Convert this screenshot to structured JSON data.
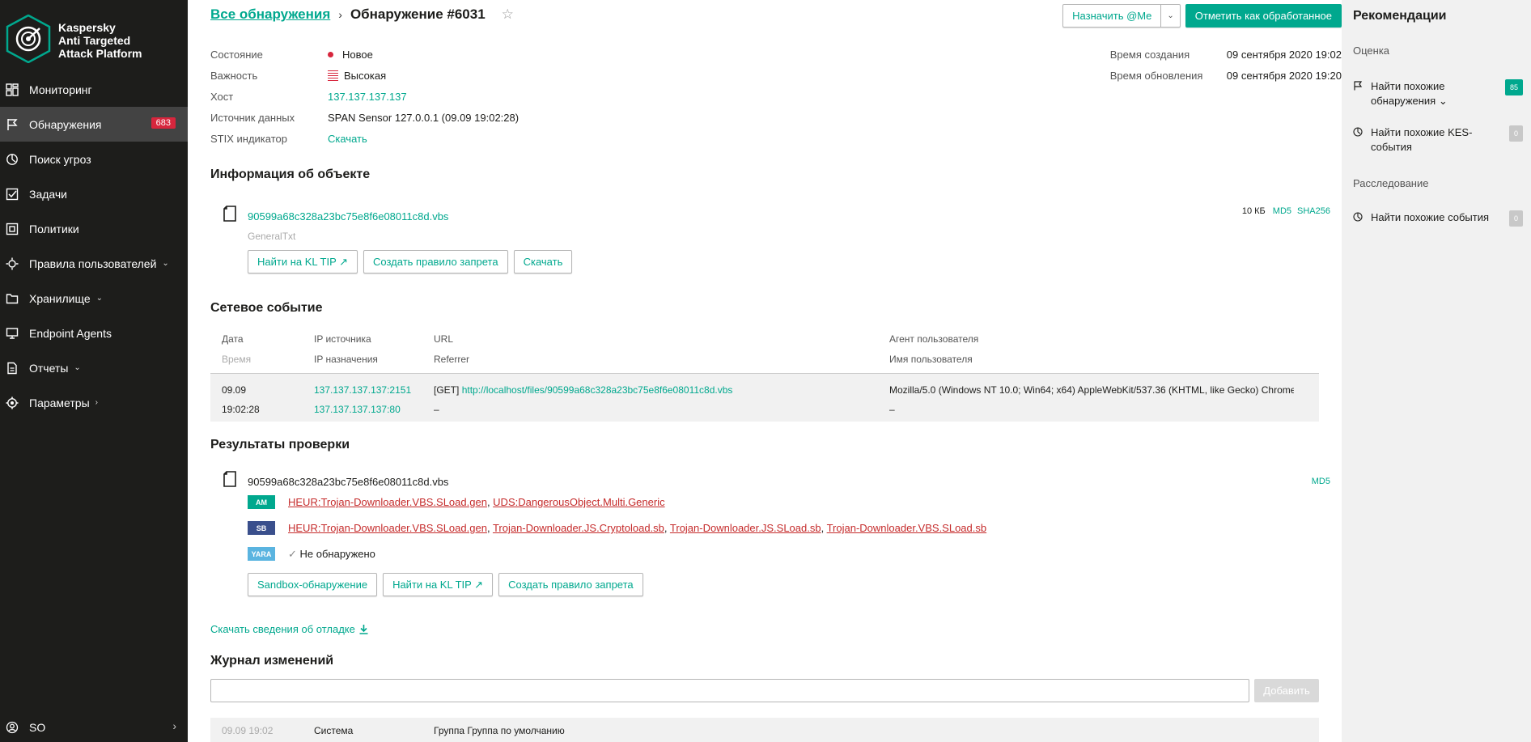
{
  "brand": {
    "line1": "Kaspersky",
    "line2": "Anti Targeted",
    "line3": "Attack Platform"
  },
  "nav": [
    {
      "label": "Мониторинг",
      "icon": "dashboard-icon"
    },
    {
      "label": "Обнаружения",
      "icon": "flag-icon",
      "badge": "683",
      "active": true
    },
    {
      "label": "Поиск угроз",
      "icon": "threat-hunting-icon"
    },
    {
      "label": "Задачи",
      "icon": "tasks-icon"
    },
    {
      "label": "Политики",
      "icon": "policies-icon"
    },
    {
      "label": "Правила пользователей",
      "icon": "user-rules-icon",
      "chevron": "⌄"
    },
    {
      "label": "Хранилище",
      "icon": "storage-icon",
      "chevron": "⌄"
    },
    {
      "label": "Endpoint Agents",
      "icon": "monitor-icon"
    },
    {
      "label": "Отчеты",
      "icon": "reports-icon",
      "chevron": "⌄"
    },
    {
      "label": "Параметры",
      "icon": "settings-icon",
      "chevron": "›"
    }
  ],
  "user": {
    "label": "SO",
    "arrow": "›"
  },
  "breadcrumb": {
    "link": "Все обнаружения",
    "sep": "›",
    "current": "Обнаружение #6031",
    "star": "☆"
  },
  "actions": {
    "assign": "Назначить @Me",
    "assign_arrow": "⌄",
    "mark": "Отметить как обработанное"
  },
  "props": {
    "state_label": "Состояние",
    "state_value": "Новое",
    "severity_label": "Важность",
    "severity_value": "Высокая",
    "host_label": "Хост",
    "host_value": "137.137.137.137",
    "source_label": "Источник данных",
    "source_value": "SPAN Sensor 127.0.0.1 (09.09 19:02:28)",
    "stix_label": "STIX индикатор",
    "stix_value": "Скачать"
  },
  "times": {
    "created_label": "Время создания",
    "created_value": "09 сентября 2020 19:02",
    "updated_label": "Время обновления",
    "updated_value": "09 сентября 2020 19:20"
  },
  "object_info": {
    "title": "Информация об объекте",
    "filename": "90599a68c328a23bc75e8f6e08011c8d.vbs",
    "type": "GeneralTxt",
    "size": "10 КБ",
    "md5": "MD5",
    "sha256": "SHA256",
    "btn_kltip": "Найти на KL TIP ↗",
    "btn_rule": "Создать правило запрета",
    "btn_download": "Скачать"
  },
  "network": {
    "title": "Сетевое событие",
    "headers": {
      "date": "Дата",
      "time": "Время",
      "src_ip": "IP источника",
      "dst_ip": "IP назначения",
      "url": "URL",
      "referrer": "Referrer",
      "ua": "Агент пользователя",
      "username": "Имя пользователя"
    },
    "row": {
      "date": "09.09",
      "time": "19:02:28",
      "src_ip": "137.137.137.137:2151",
      "dst_ip": "137.137.137.137:80",
      "method": "[GET]",
      "url": "http://localhost/files/90599a68c328a23bc75e8f6e08011c8d.vbs",
      "referrer": "–",
      "ua": "Mozilla/5.0 (Windows NT 10.0; Win64; x64) AppleWebKit/537.36 (KHTML, like Gecko) Chrome...",
      "username": "–"
    }
  },
  "scan": {
    "title": "Результаты проверки",
    "filename": "90599a68c328a23bc75e8f6e08011c8d.vbs",
    "md5": "MD5",
    "am_tag": "AM",
    "sb_tag": "SB",
    "yara_tag": "YARA",
    "am": [
      "HEUR:Trojan-Downloader.VBS.SLoad.gen",
      "UDS:DangerousObject.Multi.Generic"
    ],
    "sb": [
      "HEUR:Trojan-Downloader.VBS.SLoad.gen",
      "Trojan-Downloader.JS.Cryptoload.sb",
      "Trojan-Downloader.JS.SLoad.sb",
      "Trojan-Downloader.VBS.SLoad.sb"
    ],
    "yara_check": "✓",
    "yara": "Не обнаружено",
    "btn_sandbox": "Sandbox-обнаружение",
    "btn_kltip": "Найти на KL TIP ↗",
    "btn_rule": "Создать правило запрета"
  },
  "debug_link": "Скачать сведения об отладке",
  "log": {
    "title": "Журнал изменений",
    "input_value": "",
    "add": "Добавить",
    "row": {
      "date": "09.09 19:02",
      "actor": "Система",
      "text": "Группа Группа по умолчанию"
    }
  },
  "recommendations": {
    "title": "Рекомендации",
    "assessment": "Оценка",
    "similar_detections": "Найти похожие обнаружения ⌄",
    "similar_detections_count": "85",
    "similar_kes": "Найти похожие KES-события",
    "similar_kes_count": "0",
    "investigation": "Расследование",
    "similar_events": "Найти похожие события",
    "similar_events_count": "0"
  },
  "colors": {
    "accent": "#00a88e",
    "danger": "#d7263d",
    "sidebar": "#1d1d1b",
    "panel": "#f1f1f1"
  }
}
